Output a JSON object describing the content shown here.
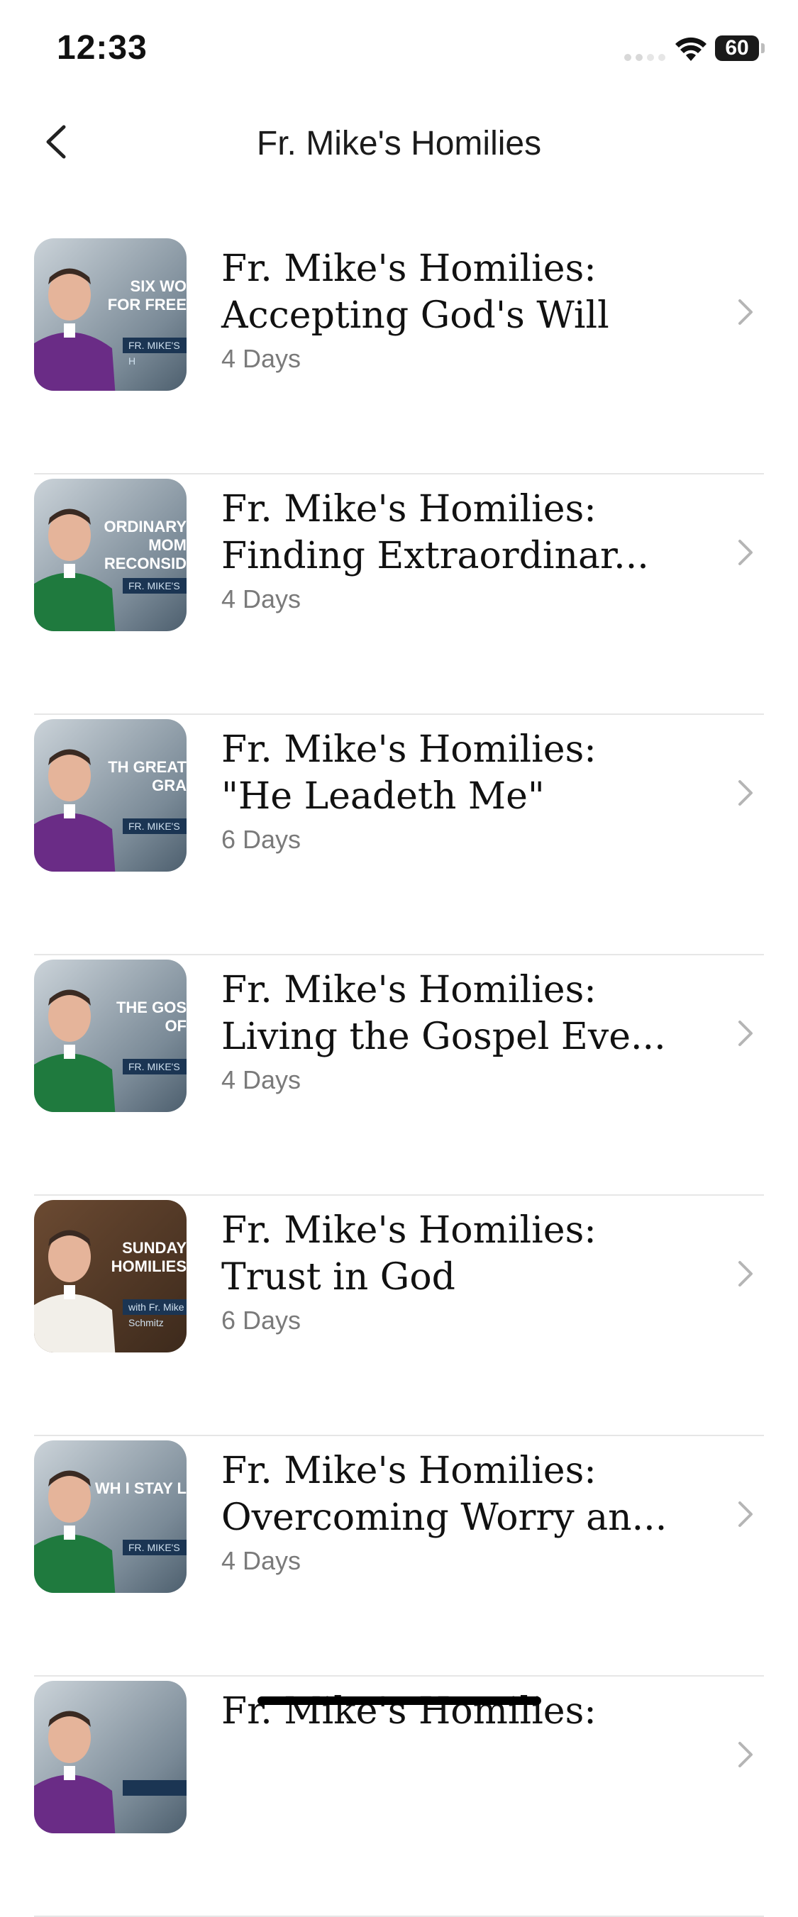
{
  "status": {
    "time": "12:33",
    "battery": "60"
  },
  "header": {
    "title": "Fr. Mike's Homilies"
  },
  "items": [
    {
      "title": "Fr. Mike's Homilies: Accepting God's Will",
      "duration": "4 Days",
      "thumb_caption": "SIX WO FOR FREE",
      "thumb_tag": "FR. MIKE'S H",
      "vestment": "#6a2c86"
    },
    {
      "title": "Fr. Mike's Homilies: Finding Extraordinar...",
      "duration": "4 Days",
      "thumb_caption": "ORDINARY MOM RECONSID",
      "thumb_tag": "FR. MIKE'S",
      "vestment": "#1f7a3e"
    },
    {
      "title": "Fr. Mike's Homilies: \"He Leadeth Me\"",
      "duration": "6 Days",
      "thumb_caption": "TH GREAT GRA",
      "thumb_tag": "FR. MIKE'S",
      "vestment": "#6a2c86"
    },
    {
      "title": "Fr. Mike's Homilies: Living the Gospel Eve...",
      "duration": "4 Days",
      "thumb_caption": "THE GOS OF",
      "thumb_tag": "FR. MIKE'S",
      "vestment": "#1f7a3e"
    },
    {
      "title": "Fr. Mike's Homilies: Trust in God",
      "duration": "6 Days",
      "thumb_caption": "SUNDAY HOMILIES",
      "thumb_tag": "with Fr. Mike Schmitz",
      "vestment": "#f2efe9"
    },
    {
      "title": "Fr. Mike's Homilies: Overcoming Worry an...",
      "duration": "4 Days",
      "thumb_caption": "WH I STAY L",
      "thumb_tag": "FR. MIKE'S",
      "vestment": "#1f7a3e"
    },
    {
      "title": "Fr. Mike's Homilies:",
      "duration": "",
      "thumb_caption": "",
      "thumb_tag": "",
      "vestment": "#6a2c86"
    }
  ]
}
